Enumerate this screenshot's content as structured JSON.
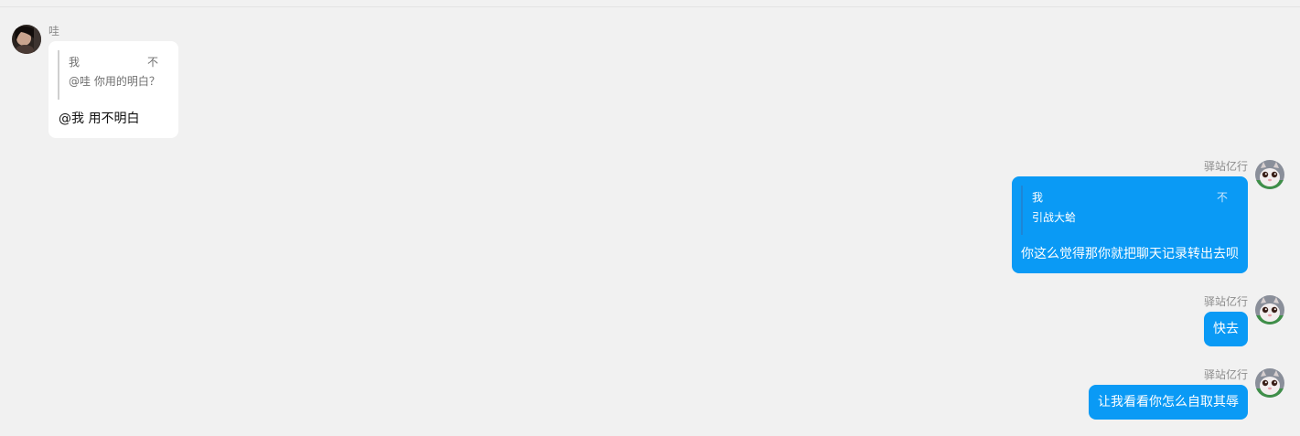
{
  "messages": [
    {
      "side": "left",
      "sender": "哇",
      "quote": {
        "name": "我",
        "mark": "不",
        "text": "@哇 你用的明白？"
      },
      "text": "@我 用不明白"
    },
    {
      "side": "right",
      "sender": "驿站亿行",
      "quote": {
        "name": "我",
        "mark": "不",
        "text": "引战大蛤"
      },
      "text": "你这么觉得那你就把聊天记录转出去呗"
    },
    {
      "side": "right",
      "sender": "驿站亿行",
      "text": "快去"
    },
    {
      "side": "right",
      "sender": "驿站亿行",
      "text": "让我看看你怎么自取其辱"
    }
  ],
  "colors": {
    "background": "#f1f1f1",
    "self_bubble": "#0a9af5",
    "other_bubble": "#ffffff",
    "name_text": "#8c8c8c"
  },
  "icons": {
    "left_avatar": "dark-portrait-avatar",
    "right_avatar": "cat-avatar"
  }
}
